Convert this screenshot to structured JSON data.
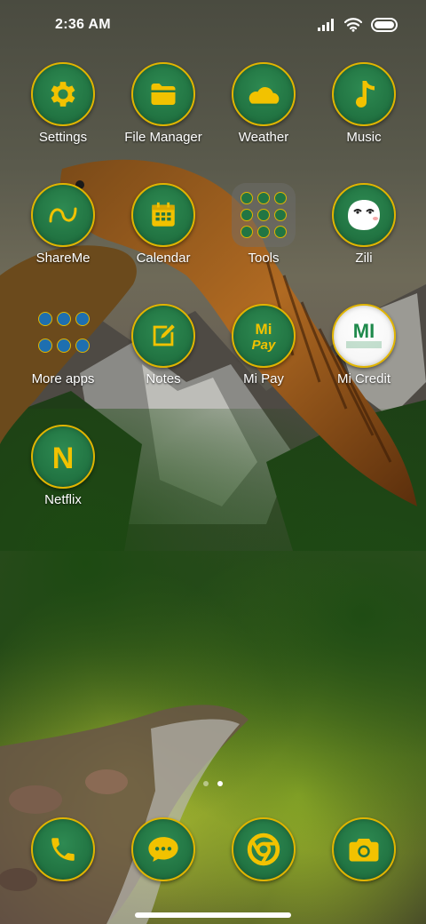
{
  "status_bar": {
    "time": "2:36 AM",
    "icons": [
      "signal-icon",
      "wifi-icon",
      "battery-icon"
    ]
  },
  "home_screen": {
    "apps": [
      {
        "label": "Settings",
        "icon": "gear-icon"
      },
      {
        "label": "File Manager",
        "icon": "folder-icon"
      },
      {
        "label": "Weather",
        "icon": "weather-cloud-icon"
      },
      {
        "label": "Music",
        "icon": "music-note-icon"
      },
      {
        "label": "ShareMe",
        "icon": "shareme-icon"
      },
      {
        "label": "Calendar",
        "icon": "calendar-icon"
      },
      {
        "label": "Tools",
        "icon": "tools-folder-icon"
      },
      {
        "label": "Zili",
        "icon": "zili-face-icon"
      },
      {
        "label": "More apps",
        "icon": "more-apps-folder-icon"
      },
      {
        "label": "Notes",
        "icon": "notes-icon"
      },
      {
        "label": "Mi Pay",
        "icon": "mi-pay-icon",
        "icon_text": "Mi Pay"
      },
      {
        "label": "Mi Credit",
        "icon": "mi-credit-icon"
      },
      {
        "label": "Netflix",
        "icon": "netflix-icon",
        "icon_text": "N"
      }
    ]
  },
  "page_indicator": {
    "count": 2,
    "active": 1
  },
  "dock": [
    {
      "name": "phone",
      "icon": "phone-icon"
    },
    {
      "name": "messages",
      "icon": "message-icon"
    },
    {
      "name": "browser",
      "icon": "chrome-icon"
    },
    {
      "name": "camera",
      "icon": "camera-icon"
    }
  ],
  "colors": {
    "icon_fill": "#227543",
    "icon_ring": "#e0b400",
    "glyph_gold": "#f2c200",
    "label_text": "#ffffff"
  }
}
